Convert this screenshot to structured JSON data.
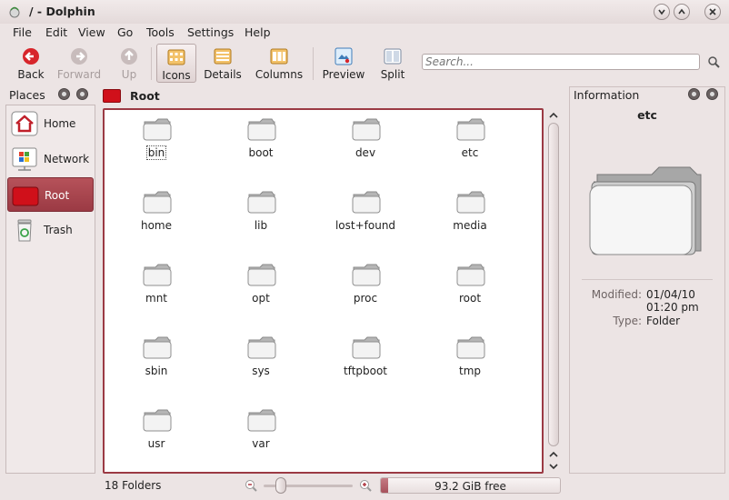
{
  "window": {
    "title": "/ - Dolphin"
  },
  "menu": [
    "File",
    "Edit",
    "View",
    "Go",
    "Tools",
    "Settings",
    "Help"
  ],
  "toolbar": {
    "back": "Back",
    "forward": "Forward",
    "up": "Up",
    "icons": "Icons",
    "details": "Details",
    "columns": "Columns",
    "preview": "Preview",
    "split": "Split",
    "search_placeholder": "Search..."
  },
  "places": {
    "title": "Places",
    "items": [
      {
        "label": "Home",
        "icon": "home-icon"
      },
      {
        "label": "Network",
        "icon": "network-icon"
      },
      {
        "label": "Root",
        "icon": "root-folder-icon",
        "selected": true
      },
      {
        "label": "Trash",
        "icon": "trash-icon"
      }
    ]
  },
  "location": {
    "breadcrumb": "Root"
  },
  "files": [
    "bin",
    "boot",
    "dev",
    "etc",
    "home",
    "lib",
    "lost+found",
    "media",
    "mnt",
    "opt",
    "proc",
    "root",
    "sbin",
    "sys",
    "tftpboot",
    "tmp",
    "usr",
    "var"
  ],
  "info": {
    "title": "Information",
    "name": "etc",
    "modified_label": "Modified:",
    "modified_date": "01/04/10",
    "modified_time": "01:20 pm",
    "type_label": "Type:",
    "type_value": "Folder"
  },
  "status": {
    "folders": "18 Folders",
    "free": "93.2 GiB free",
    "used_fraction": 0.04,
    "zoom_fraction": 0.15
  },
  "colors": {
    "accent": "#9b3a44",
    "root_red": "#d0101a"
  }
}
